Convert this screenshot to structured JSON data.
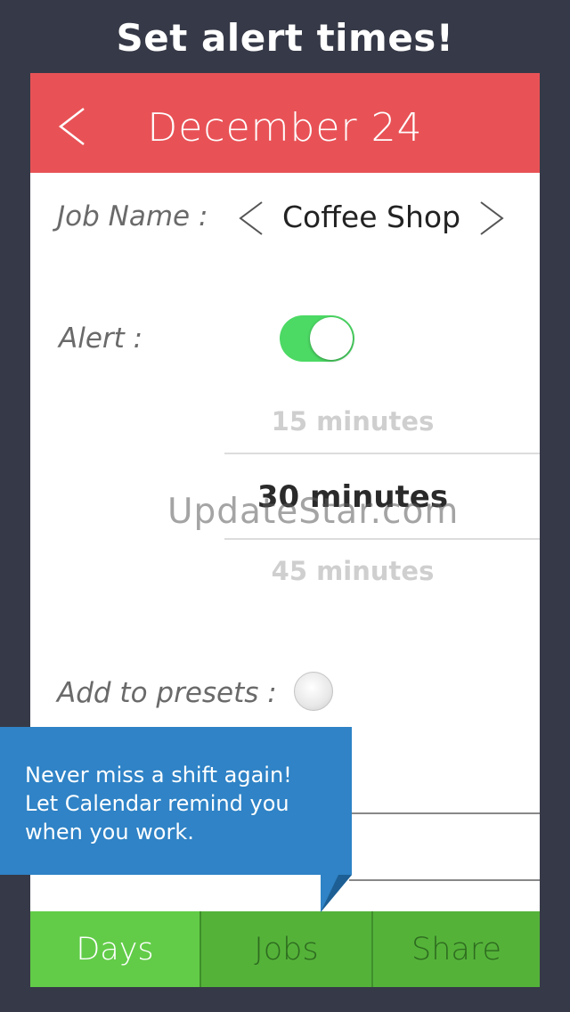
{
  "promo": {
    "title": "Set alert times!"
  },
  "header": {
    "title": "December 24",
    "back_icon": "chevron-left-icon"
  },
  "job": {
    "label": "Job Name :",
    "value": "Coffee Shop",
    "prev_icon": "chevron-left-icon",
    "next_icon": "chevron-right-icon"
  },
  "alert": {
    "label": "Alert :",
    "enabled": true,
    "toggle_color": "#4cd964"
  },
  "picker": {
    "options": [
      "15 minutes",
      "30 minutes",
      "45 minutes"
    ],
    "selected": "30 minutes"
  },
  "watermark": {
    "text": "UpdateStar.com"
  },
  "presets": {
    "label": "Add to presets :",
    "checked": false
  },
  "tooltip": {
    "lines": [
      "Never miss a shift again!",
      "Let Calendar remind you",
      "when you work."
    ],
    "color": "#2f83c6"
  },
  "tabs": [
    {
      "label": "Days",
      "active": true
    },
    {
      "label": "Jobs",
      "active": false
    },
    {
      "label": "Share",
      "active": false
    }
  ],
  "colors": {
    "header": "#e85256",
    "tab_active": "#62cc48",
    "tab_inactive": "#54b239",
    "background": "#363947"
  }
}
